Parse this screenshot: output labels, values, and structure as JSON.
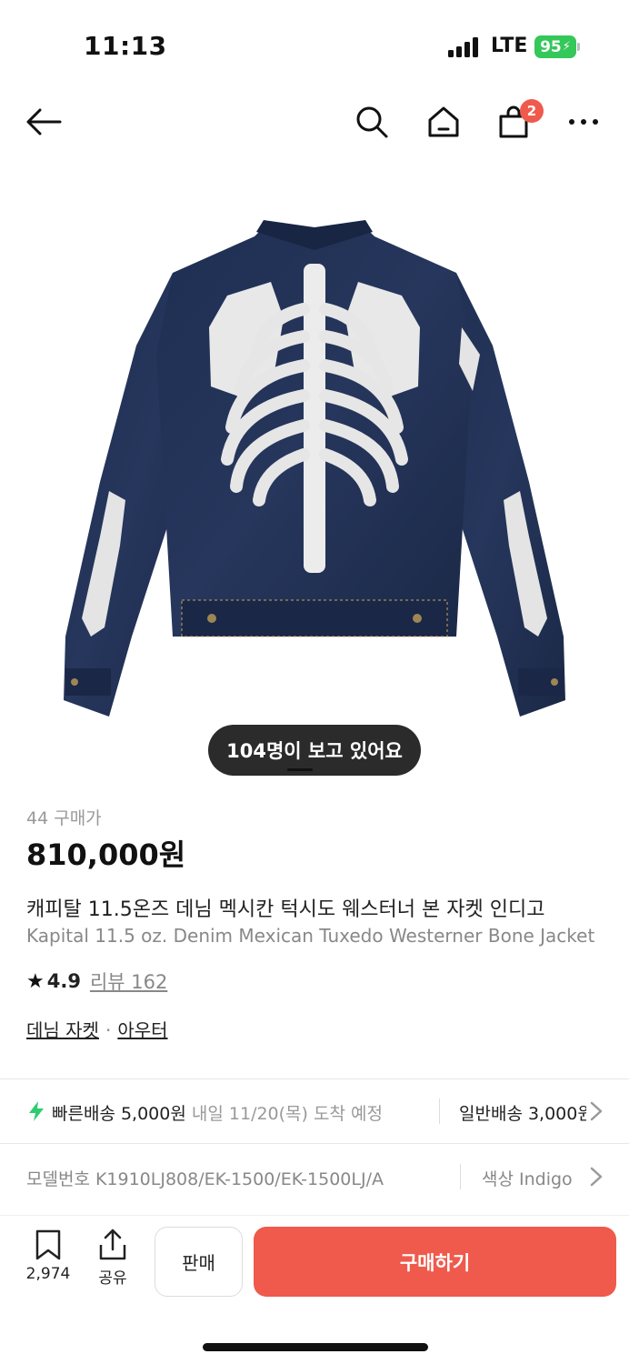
{
  "status_bar": {
    "time": "11:13",
    "network": "LTE",
    "battery": "95"
  },
  "nav": {
    "cart_badge": "2"
  },
  "product": {
    "viewers_text": "104명이 보고 있어요",
    "purchase_count": "44 구매가",
    "price": "810,000원",
    "title_ko": "캐피탈 11.5온즈 데님 멕시칸 턱시도 웨스터너 본 자켓 인디고",
    "title_en": "Kapital 11.5 oz. Denim Mexican Tuxedo Westerner Bone Jacket",
    "rating": "4.9",
    "review_label": "리뷰 162",
    "categories": [
      "데님 자켓",
      "아우터"
    ]
  },
  "shipping": {
    "fast_label": "빠른배송 5,000원",
    "fast_eta": "내일 11/20(목) 도착 예정",
    "normal_label": "일반배송 3,000원"
  },
  "details": {
    "model_number": "모델번호 K1910LJ808/EK-1500/EK-1500LJ/A",
    "color": "색상 Indigo"
  },
  "bottom_bar": {
    "bookmark_count": "2,974",
    "share_label": "공유",
    "sell_label": "판매",
    "buy_label": "구매하기"
  },
  "colors": {
    "accent": "#ef5a4c",
    "fast_ship": "#2ecc71",
    "pill": "#2b2b2b"
  },
  "icons": [
    "back-arrow-icon",
    "search-icon",
    "home-icon",
    "cart-icon",
    "more-icon",
    "bolt-icon",
    "chevron-right-icon",
    "bookmark-icon",
    "share-icon"
  ]
}
